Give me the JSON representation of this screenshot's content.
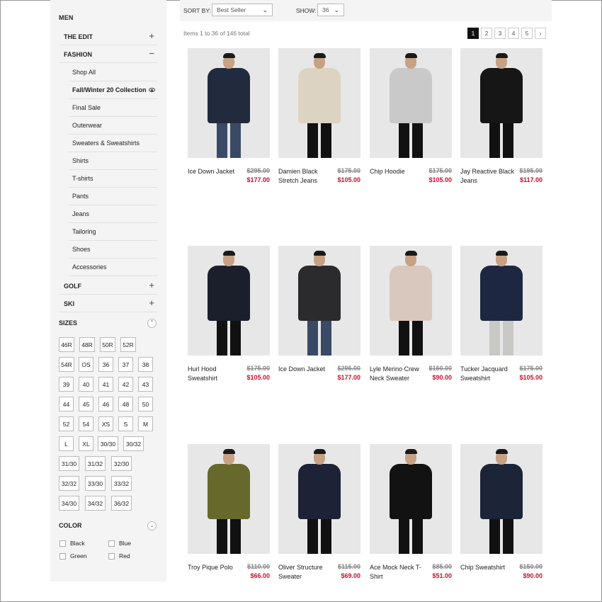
{
  "sidebar": {
    "title": "MEN",
    "categories": [
      {
        "label": "THE EDIT",
        "sign": "+"
      },
      {
        "label": "FASHION",
        "sign": "−"
      },
      {
        "label": "GOLF",
        "sign": "+"
      },
      {
        "label": "SKI",
        "sign": "+"
      }
    ],
    "fashion_items": [
      "Shop All",
      "Fall/Winter 20 Collection",
      "Final Sale",
      "Outerwear",
      "Sweaters & Sweatshirts",
      "Shirts",
      "T-shirts",
      "Pants",
      "Jeans",
      "Tailoring",
      "Shoes",
      "Accessories"
    ],
    "sizes_title": "SIZES",
    "sizes": [
      [
        "46R",
        "48R",
        "50R",
        "52R"
      ],
      [
        "54R",
        "OS",
        "36",
        "37",
        "38"
      ],
      [
        "39",
        "40",
        "41",
        "42",
        "43"
      ],
      [
        "44",
        "45",
        "46",
        "48",
        "50"
      ],
      [
        "52",
        "54",
        "XS",
        "S",
        "M"
      ],
      [
        "L",
        "XL",
        "30/30",
        "30/32"
      ],
      [
        "31/30",
        "31/32",
        "32/30"
      ],
      [
        "32/32",
        "33/30",
        "33/32"
      ],
      [
        "34/30",
        "34/32",
        "36/32"
      ]
    ],
    "color_title": "COLOR",
    "colors": [
      "Black",
      "Blue",
      "Green",
      "Red"
    ]
  },
  "toolbar": {
    "sort_label": "SORT BY:",
    "sort_value": "Best Seller",
    "show_label": "SHOW:",
    "show_value": "36"
  },
  "items_count": "Items 1 to 36 of 146 total",
  "pager": [
    "1",
    "2",
    "3",
    "4",
    "5",
    "›"
  ],
  "products": [
    {
      "name": "Ice Down Jacket",
      "old": "$295.00",
      "new": "$177.00",
      "top": "#222a3d",
      "bottom": "#3a4a66"
    },
    {
      "name": "Damien Black Stretch Jeans",
      "old": "$175.00",
      "new": "$105.00",
      "top": "#ddd3c3",
      "bottom": "#111111"
    },
    {
      "name": "Chip Hoodie",
      "old": "$175.00",
      "new": "$105.00",
      "top": "#c9c9c9",
      "bottom": "#111111"
    },
    {
      "name": "Jay Reactive Black Jeans",
      "old": "$195.00",
      "new": "$117.00",
      "top": "#161616",
      "bottom": "#111111"
    },
    {
      "name": "Hurl Hood Sweatshirt",
      "old": "$175.00",
      "new": "$105.00",
      "top": "#1b1f2b",
      "bottom": "#111111"
    },
    {
      "name": "Ice Down Jacket",
      "old": "$295.00",
      "new": "$177.00",
      "top": "#2b2b2e",
      "bottom": "#3a4a66"
    },
    {
      "name": "Lyle Merino Crew Neck Sweater",
      "old": "$150.00",
      "new": "$90.00",
      "top": "#d9c8bd",
      "bottom": "#111111"
    },
    {
      "name": "Tucker Jacquard Sweatshirt",
      "old": "$175.00",
      "new": "$105.00",
      "top": "#1e2741",
      "bottom": "#c8c8c4"
    },
    {
      "name": "Troy Pique Polo",
      "old": "$110.00",
      "new": "$66.00",
      "top": "#66682c",
      "bottom": "#111111"
    },
    {
      "name": "Oliver Structure Sweater",
      "old": "$115.00",
      "new": "$69.00",
      "top": "#1d2236",
      "bottom": "#111111"
    },
    {
      "name": "Ace Mock Neck T-Shirt",
      "old": "$85.00",
      "new": "$51.00",
      "top": "#121212",
      "bottom": "#111111"
    },
    {
      "name": "Chip Sweatshirt",
      "old": "$150.00",
      "new": "$90.00",
      "top": "#1c2438",
      "bottom": "#111111"
    }
  ]
}
